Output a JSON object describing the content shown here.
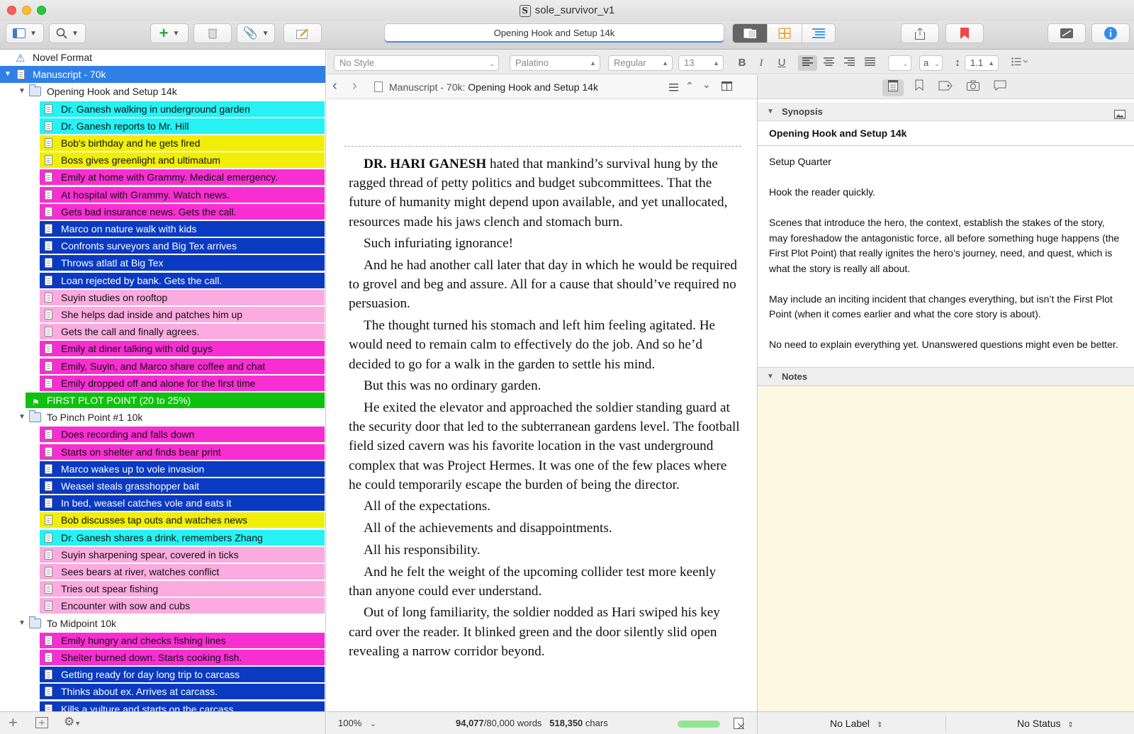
{
  "window": {
    "title": "sole_survivor_v1"
  },
  "toolbar": {
    "document_title": "Opening Hook and Setup 14k"
  },
  "binder": {
    "items": [
      {
        "label": "Novel Format",
        "level": 0,
        "type": "warning",
        "color": ""
      },
      {
        "label": "Manuscript - 70k",
        "level": 0,
        "type": "manuscript",
        "color": "selected"
      },
      {
        "label": "Opening Hook and Setup 14k",
        "level": 1,
        "type": "folder",
        "color": ""
      },
      {
        "label": "Dr. Ganesh walking in underground garden",
        "level": 2,
        "type": "doc",
        "color": "#26f2f4"
      },
      {
        "label": "Dr. Ganesh reports to Mr. Hill",
        "level": 2,
        "type": "doc",
        "color": "#26f2f4"
      },
      {
        "label": "Bob's birthday and he gets fired",
        "level": 2,
        "type": "doc",
        "color": "#f1ef0a"
      },
      {
        "label": "Boss gives greenlight and ultimatum",
        "level": 2,
        "type": "doc",
        "color": "#f1ef0a"
      },
      {
        "label": "Emily at home with Grammy. Medical emergency.",
        "level": 2,
        "type": "doc",
        "color": "#f72fd2"
      },
      {
        "label": "At hospital with Grammy. Watch news.",
        "level": 2,
        "type": "doc",
        "color": "#f72fd2"
      },
      {
        "label": "Gets bad insurance news. Gets the call.",
        "level": 2,
        "type": "doc",
        "color": "#f72fd2"
      },
      {
        "label": "Marco on nature walk with kids",
        "level": 2,
        "type": "doc",
        "color": "#0a3ac1"
      },
      {
        "label": "Confronts surveyors and Big Tex arrives",
        "level": 2,
        "type": "doc",
        "color": "#0a3ac1"
      },
      {
        "label": "Throws atlatl at Big Tex",
        "level": 2,
        "type": "doc",
        "color": "#0a3ac1"
      },
      {
        "label": "Loan rejected by bank. Gets the call.",
        "level": 2,
        "type": "doc",
        "color": "#0a3ac1"
      },
      {
        "label": "Suyin studies on rooftop",
        "level": 2,
        "type": "doc",
        "color": "#fbabdf"
      },
      {
        "label": "She helps dad inside and patches him up",
        "level": 2,
        "type": "doc",
        "color": "#fbabdf"
      },
      {
        "label": "Gets the call and finally agrees.",
        "level": 2,
        "type": "doc",
        "color": "#fbabdf"
      },
      {
        "label": "Emily at diner talking with old guys",
        "level": 2,
        "type": "doc",
        "color": "#f72fd2"
      },
      {
        "label": "Emily, Suyin, and Marco share coffee and chat",
        "level": 2,
        "type": "doc",
        "color": "#f72fd2"
      },
      {
        "label": "Emily dropped off and alone for the first time",
        "level": 2,
        "type": "doc",
        "color": "#f72fd2"
      },
      {
        "label": "FIRST PLOT POINT  (20 to 25%)",
        "level": 1,
        "type": "flag",
        "color": "#0fc10f"
      },
      {
        "label": "To Pinch Point #1 10k",
        "level": 1,
        "type": "folder",
        "color": ""
      },
      {
        "label": "Does recording and falls down",
        "level": 2,
        "type": "doc",
        "color": "#f72fd2"
      },
      {
        "label": "Starts on shelter and finds bear print",
        "level": 2,
        "type": "doc",
        "color": "#f72fd2"
      },
      {
        "label": "Marco wakes up to vole invasion",
        "level": 2,
        "type": "doc",
        "color": "#0a3ac1"
      },
      {
        "label": "Weasel steals grasshopper bait",
        "level": 2,
        "type": "doc",
        "color": "#0a3ac1"
      },
      {
        "label": "In bed, weasel catches vole and eats it",
        "level": 2,
        "type": "doc",
        "color": "#0a3ac1"
      },
      {
        "label": "Bob discusses tap outs and watches news",
        "level": 2,
        "type": "doc",
        "color": "#f1ef0a"
      },
      {
        "label": "Dr. Ganesh shares a drink, remembers Zhang",
        "level": 2,
        "type": "doc",
        "color": "#26f2f4"
      },
      {
        "label": "Suyin sharpening spear, covered in ticks",
        "level": 2,
        "type": "doc",
        "color": "#fbabdf"
      },
      {
        "label": "Sees bears at river, watches conflict",
        "level": 2,
        "type": "doc",
        "color": "#fbabdf"
      },
      {
        "label": "Tries out spear fishing",
        "level": 2,
        "type": "doc",
        "color": "#fbabdf"
      },
      {
        "label": "Encounter with sow and cubs",
        "level": 2,
        "type": "doc",
        "color": "#fbabdf"
      },
      {
        "label": "To Midpoint 10k",
        "level": 1,
        "type": "folder",
        "color": ""
      },
      {
        "label": "Emily hungry and checks fishing lines",
        "level": 2,
        "type": "doc",
        "color": "#f72fd2"
      },
      {
        "label": "Shelter burned down. Starts cooking fish.",
        "level": 2,
        "type": "doc",
        "color": "#f72fd2"
      },
      {
        "label": "Getting ready for day long trip to carcass",
        "level": 2,
        "type": "doc",
        "color": "#0a3ac1"
      },
      {
        "label": "Thinks about ex. Arrives at carcass.",
        "level": 2,
        "type": "doc",
        "color": "#0a3ac1"
      },
      {
        "label": "Kills a vulture and starts on the carcass",
        "level": 2,
        "type": "doc",
        "color": "#0a3ac1"
      }
    ]
  },
  "format_bar": {
    "style": "No Style",
    "font": "Palatino",
    "weight": "Regular",
    "size": "13",
    "line_spacing": "1.1",
    "bold": "B",
    "italic": "I",
    "underline": "U",
    "text_color": "a"
  },
  "editor": {
    "path_prefix": "Manuscript - 70k:",
    "path_current": "Opening Hook and Setup 14k",
    "lead_bold": "DR. HARI GANESH",
    "paragraphs": [
      "hated that mankind’s survival hung by the ragged thread of petty politics and budget subcommittees. That the future of humanity might depend upon available, and yet unallocated, resources made his jaws clench and stomach burn.",
      "Such infuriating ignorance!",
      "And he had another call later that day in which he would be required to grovel and beg and assure. All for a cause that should’ve required no persuasion.",
      "The thought turned his stomach and left him feeling agitated. He would need to remain calm to effectively do the job. And so he’d decided to go for a walk in the garden to settle his mind.",
      "But this was no ordinary garden.",
      "He exited the elevator and approached the soldier standing guard at the security door that led to the subterranean gardens level. The football field sized cavern was his favorite location in the vast underground complex that was Project Hermes. It was one of the few places where he could temporarily escape the burden of being the director.",
      "All of the expectations.",
      "All of the achievements and disappointments.",
      "All his responsibility.",
      "And he felt the weight of the upcoming collider test more keenly than anyone could ever understand.",
      "Out of long familiarity, the soldier nodded as Hari swiped his key card over the reader. It blinked green and the door silently slid open revealing a narrow corridor beyond."
    ],
    "zoom": "100%",
    "word_count": "94,077",
    "word_target": "/80,000 words",
    "char_count": "518,350",
    "char_suffix": "chars",
    "target_progress": 1.0
  },
  "inspector": {
    "synopsis_header": "Synopsis",
    "synopsis_title": "Opening Hook and Setup 14k",
    "synopsis_paragraphs": [
      "Setup Quarter",
      "Hook the reader quickly.",
      "Scenes that introduce the hero, the context, establish the stakes of the story, may foreshadow the antagonistic force, all before something huge happens (the First Plot Point) that really ignites the hero’s journey, need, and quest, which is what the story is really all about.",
      "May include an inciting incident that changes everything, but isn’t the First Plot Point (when it comes earlier and what the core story is about).",
      "No need to explain everything yet. Unanswered questions might even be better."
    ],
    "notes_header": "Notes",
    "label_value": "No Label",
    "status_value": "No Status"
  },
  "colors": {
    "selection": "#2f7fe6",
    "accent": "#4a90e2"
  }
}
